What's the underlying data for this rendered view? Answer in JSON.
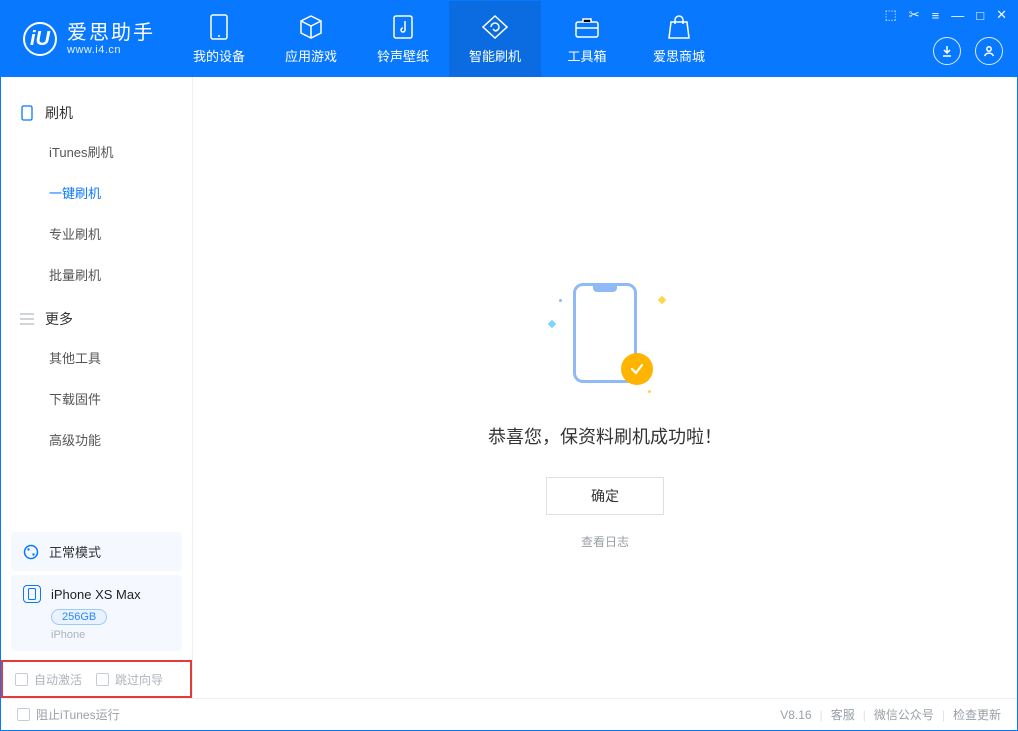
{
  "brand": {
    "title": "爱思助手",
    "subtitle": "www.i4.cn",
    "logo_letter": "iU"
  },
  "tabs": [
    {
      "label": "我的设备",
      "icon": "device-icon",
      "active": false
    },
    {
      "label": "应用游戏",
      "icon": "cube-icon",
      "active": false
    },
    {
      "label": "铃声壁纸",
      "icon": "music-icon",
      "active": false
    },
    {
      "label": "智能刷机",
      "icon": "refresh-icon",
      "active": true
    },
    {
      "label": "工具箱",
      "icon": "toolbox-icon",
      "active": false
    },
    {
      "label": "爱思商城",
      "icon": "bag-icon",
      "active": false
    }
  ],
  "win_ctrl": {
    "menu": "≡",
    "min": "—",
    "max": "□",
    "close": "✕",
    "misc1": "◇",
    "misc2": "✂"
  },
  "sidebar": {
    "group1": {
      "title": "刷机",
      "items": [
        {
          "label": "iTunes刷机",
          "active": false
        },
        {
          "label": "一键刷机",
          "active": true
        },
        {
          "label": "专业刷机",
          "active": false
        },
        {
          "label": "批量刷机",
          "active": false
        }
      ]
    },
    "group2": {
      "title": "更多",
      "items": [
        {
          "label": "其他工具",
          "active": false
        },
        {
          "label": "下载固件",
          "active": false
        },
        {
          "label": "高级功能",
          "active": false
        }
      ]
    },
    "mode_panel": "正常模式",
    "device": {
      "name": "iPhone XS Max",
      "capacity": "256GB",
      "type": "iPhone"
    },
    "checks": {
      "auto_activate": "自动激活",
      "skip_guide": "跳过向导"
    }
  },
  "main": {
    "success_title": "恭喜您，保资料刷机成功啦！",
    "ok_btn": "确定",
    "log_link": "查看日志"
  },
  "status": {
    "stop_itunes": "阻止iTunes运行",
    "version": "V8.16",
    "links": [
      "客服",
      "微信公众号",
      "检查更新"
    ]
  }
}
